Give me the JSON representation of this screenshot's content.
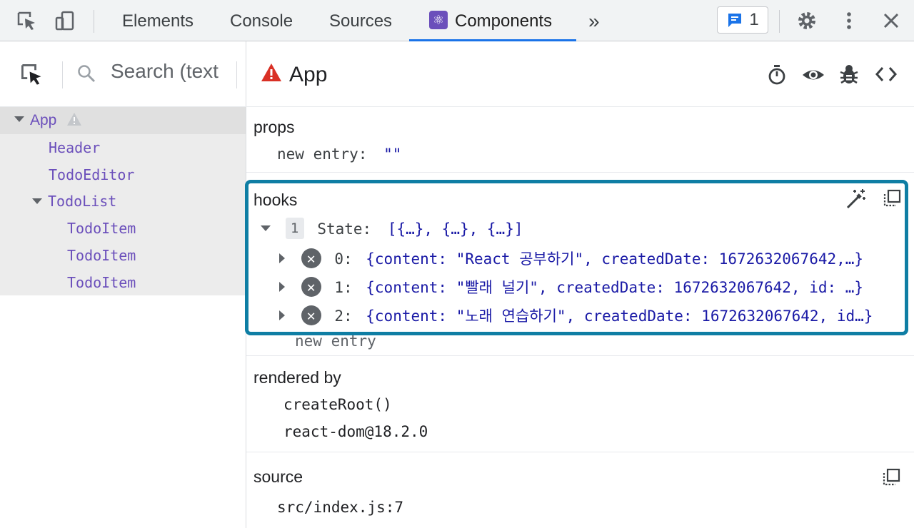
{
  "tabs": [
    {
      "label": "Elements"
    },
    {
      "label": "Console"
    },
    {
      "label": "Sources"
    },
    {
      "label": "Components",
      "active": true
    }
  ],
  "more_tabs": "»",
  "issues_count": "1",
  "search": {
    "placeholder": "Search (text"
  },
  "tree": [
    {
      "label": "App"
    },
    {
      "label": "Header"
    },
    {
      "label": "TodoEditor"
    },
    {
      "label": "TodoList"
    },
    {
      "label": "TodoItem"
    },
    {
      "label": "TodoItem"
    },
    {
      "label": "TodoItem"
    }
  ],
  "component": {
    "name": "App"
  },
  "props": {
    "title": "props",
    "key": "new entry:",
    "value": "\"\""
  },
  "hooks": {
    "title": "hooks",
    "index": "1",
    "state_key": "State:",
    "state_value": "[{…}, {…}, {…}]",
    "items": [
      {
        "key": "0:",
        "value": "{content: \"React 공부하기\", createdDate: 1672632067642,…}"
      },
      {
        "key": "1:",
        "value": "{content: \"빨래 널기\", createdDate: 1672632067642, id: …}"
      },
      {
        "key": "2:",
        "value": "{content: \"노래 연습하기\", createdDate: 1672632067642, id…}"
      }
    ],
    "new_entry": "new entry"
  },
  "rendered_by": {
    "title": "rendered by",
    "items": [
      "createRoot()",
      "react-dom@18.2.0"
    ]
  },
  "source": {
    "title": "source",
    "value": "src/index.js:7"
  },
  "colors": {
    "accent": "#1a73e8",
    "component": "#6b4fbb",
    "warning": "#d93025",
    "highlight_border": "#0f7ea4"
  }
}
